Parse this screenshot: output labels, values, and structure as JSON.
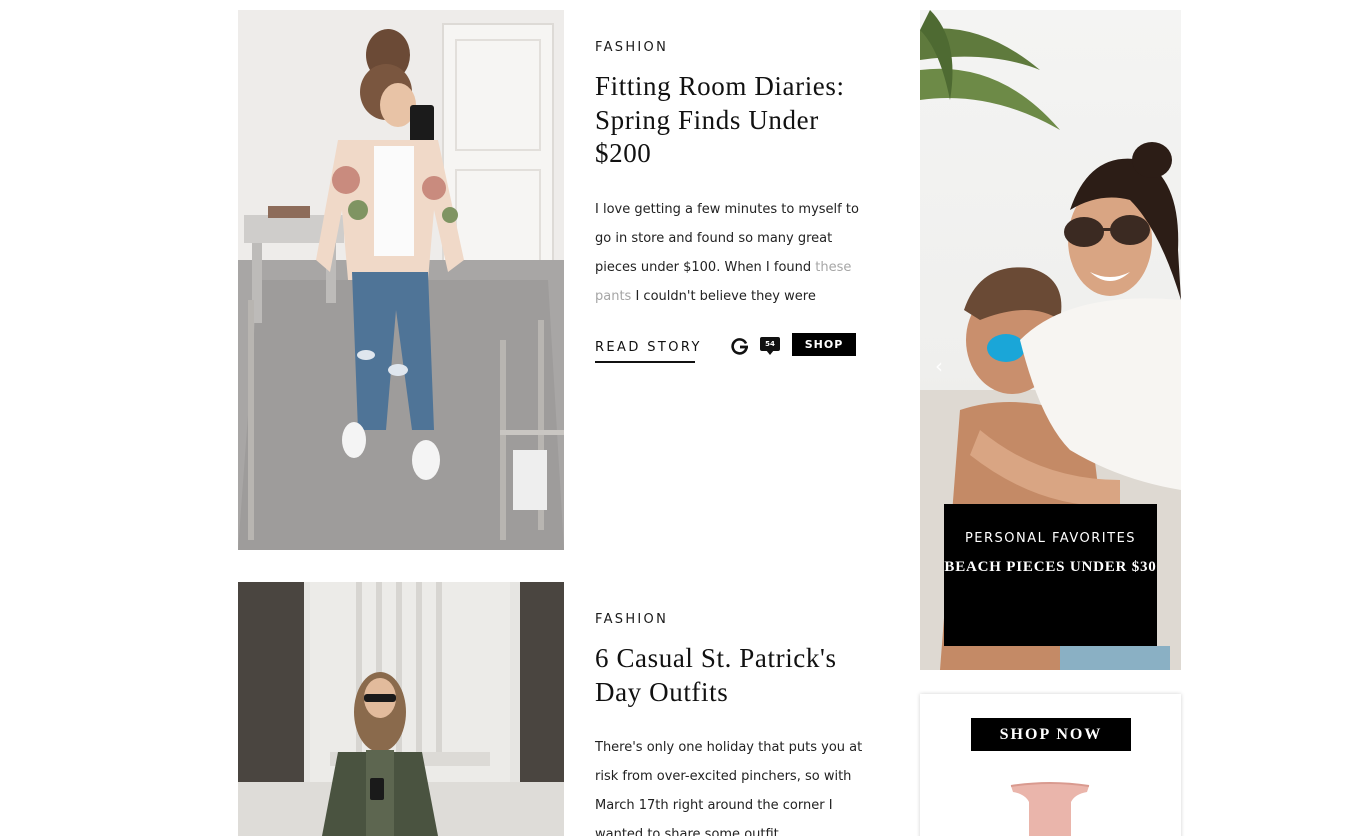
{
  "posts": [
    {
      "category": "FASHION",
      "title": "Fitting Room Diaries: Spring Finds Under $200",
      "excerpt_before": "I love getting a few minutes to myself to go in store and found so many great pieces under $100. When I found ",
      "excerpt_link": "these pants",
      "excerpt_after": " I couldn't believe they were",
      "read_more": "READ STORY",
      "comment_count": "54",
      "shop_label": "SHOP"
    },
    {
      "category": "FASHION",
      "title": "6 Casual St. Patrick's Day Outfits",
      "excerpt": "There's only one holiday that puts you at risk from over-excited pinchers, so with March 17th right around the corner I wanted to share some outfit"
    }
  ],
  "sidebar": {
    "promo": {
      "kicker": "PERSONAL FAVORITES",
      "headline": "BEACH PIECES UNDER $30",
      "prev_arrow": "‹"
    },
    "shop_card": {
      "button_label": "SHOP NOW"
    }
  },
  "colors": {
    "link_muted": "#a6a6a6",
    "button_bg": "#000000",
    "text": "#111111"
  }
}
